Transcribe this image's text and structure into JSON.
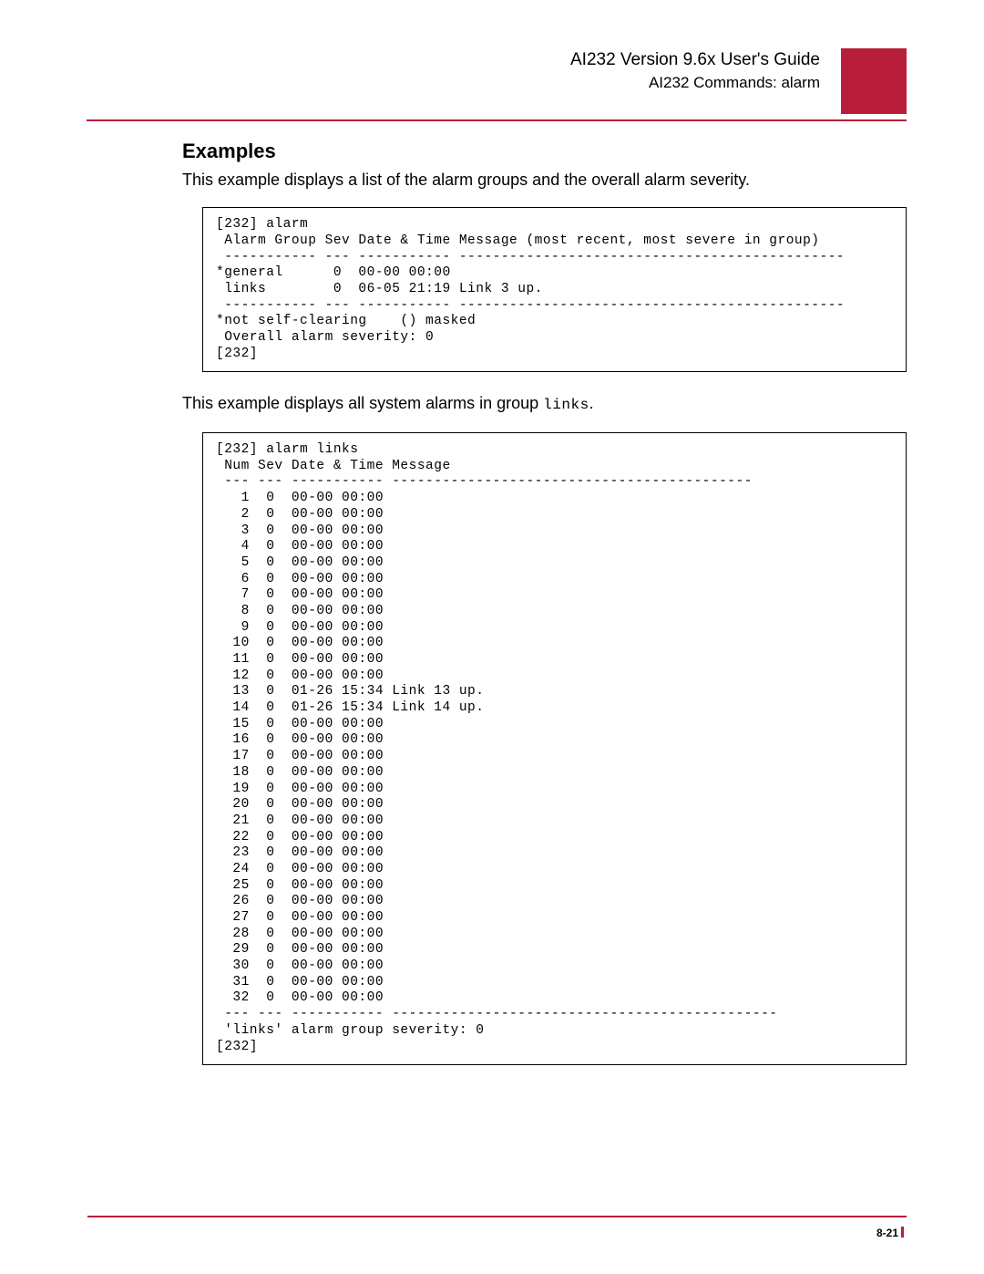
{
  "header": {
    "title": "AI232 Version 9.6x User's Guide",
    "subtitle": "AI232 Commands: alarm"
  },
  "section": {
    "heading": "Examples",
    "intro1": "This example displays a list of the alarm groups and the overall alarm severity.",
    "intro2_a": "This example displays all system alarms in group ",
    "intro2_mono": "links",
    "intro2_b": "."
  },
  "codebox1": "[232] alarm\n Alarm Group Sev Date & Time Message (most recent, most severe in group)\n ----------- --- ----------- ----------------------------------------------\n*general      0  00-00 00:00\n links        0  06-05 21:19 Link 3 up.\n ----------- --- ----------- ----------------------------------------------\n*not self-clearing    () masked\n Overall alarm severity: 0\n[232]",
  "codebox2": "[232] alarm links\n Num Sev Date & Time Message\n --- --- ----------- -------------------------------------------\n   1  0  00-00 00:00\n   2  0  00-00 00:00\n   3  0  00-00 00:00\n   4  0  00-00 00:00\n   5  0  00-00 00:00\n   6  0  00-00 00:00\n   7  0  00-00 00:00\n   8  0  00-00 00:00\n   9  0  00-00 00:00\n  10  0  00-00 00:00\n  11  0  00-00 00:00\n  12  0  00-00 00:00\n  13  0  01-26 15:34 Link 13 up.\n  14  0  01-26 15:34 Link 14 up.\n  15  0  00-00 00:00\n  16  0  00-00 00:00\n  17  0  00-00 00:00\n  18  0  00-00 00:00\n  19  0  00-00 00:00\n  20  0  00-00 00:00\n  21  0  00-00 00:00\n  22  0  00-00 00:00\n  23  0  00-00 00:00\n  24  0  00-00 00:00\n  25  0  00-00 00:00\n  26  0  00-00 00:00\n  27  0  00-00 00:00\n  28  0  00-00 00:00\n  29  0  00-00 00:00\n  30  0  00-00 00:00\n  31  0  00-00 00:00\n  32  0  00-00 00:00\n --- --- ----------- ----------------------------------------------\n 'links' alarm group severity: 0\n[232]",
  "footer": {
    "page_num": "8-21"
  }
}
